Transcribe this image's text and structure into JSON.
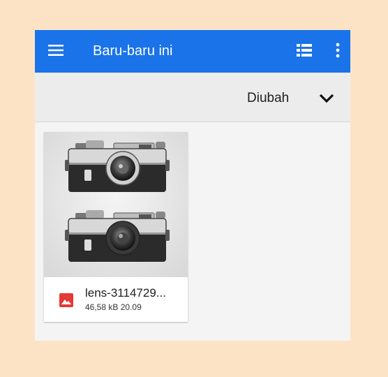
{
  "appbar": {
    "title": "Baru-baru ini",
    "color": "#1a73e8",
    "menu_icon": "hamburger-menu-icon",
    "view_icon": "list-view-icon",
    "more_icon": "more-vert-icon"
  },
  "sort": {
    "label": "Diubah",
    "icon": "chevron-down-icon"
  },
  "files": [
    {
      "name": "lens-3114729...",
      "size": "46,58 kB",
      "date": "20.09",
      "type_icon": "image-file-icon",
      "type_color": "#e53935"
    }
  ]
}
